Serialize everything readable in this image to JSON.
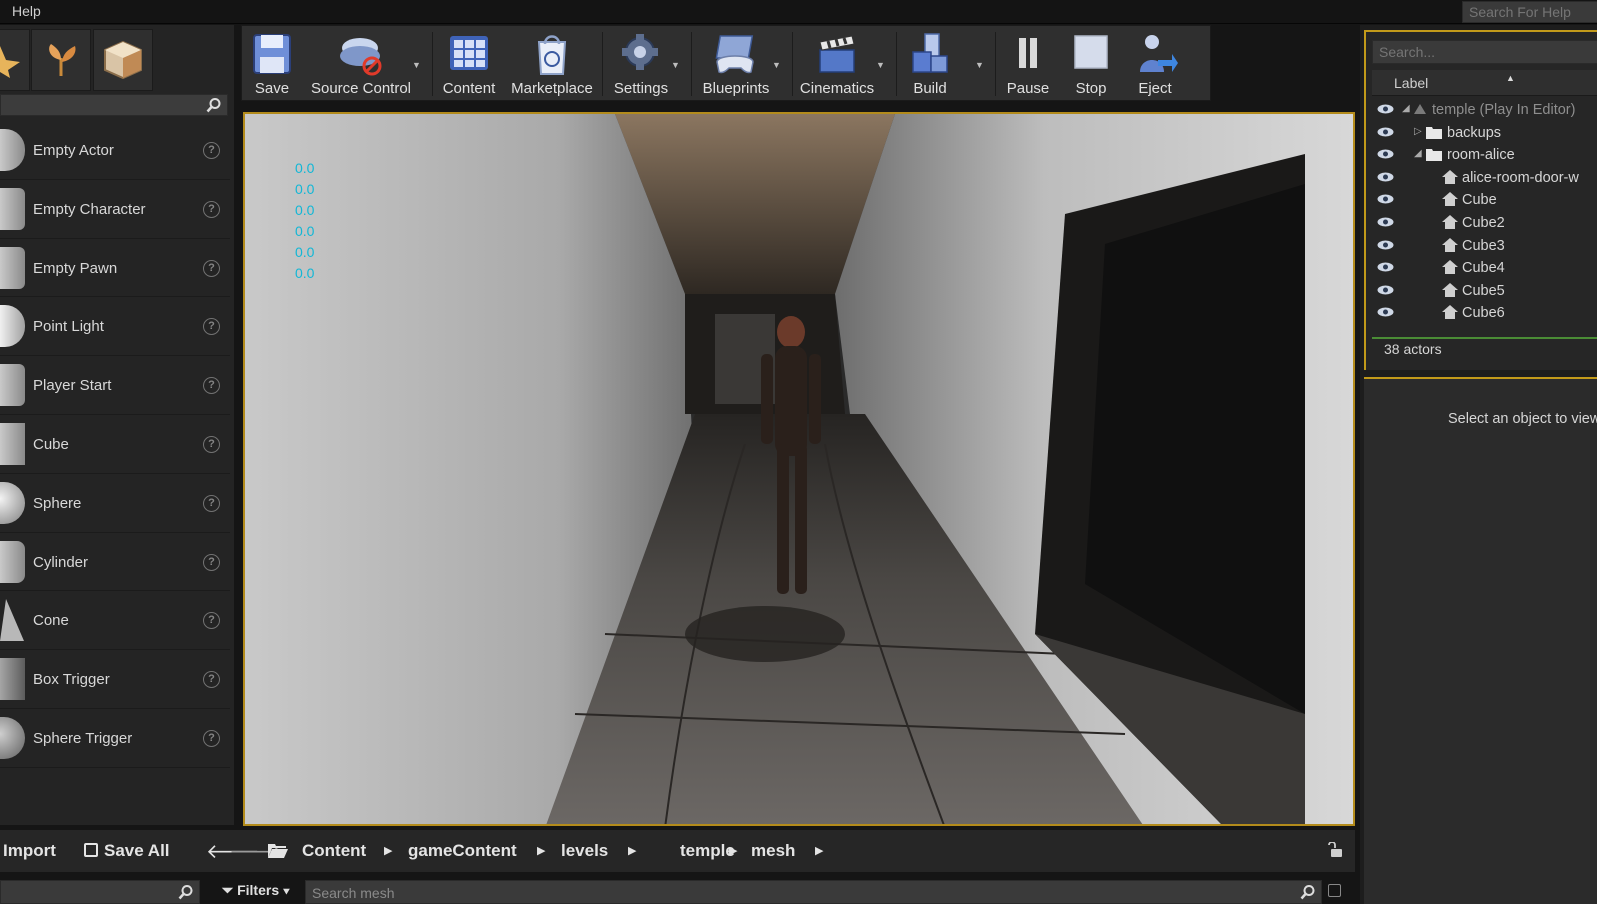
{
  "menu": {
    "help": "Help"
  },
  "help_search": {
    "placeholder": "Search For Help"
  },
  "place_panel": {
    "items": [
      {
        "label": "Empty Actor",
        "help": "?"
      },
      {
        "label": "Empty Character",
        "help": "?"
      },
      {
        "label": "Empty Pawn",
        "help": "?"
      },
      {
        "label": "Point Light",
        "help": "?"
      },
      {
        "label": "Player Start",
        "help": "?"
      },
      {
        "label": "Cube",
        "help": "?"
      },
      {
        "label": "Sphere",
        "help": "?"
      },
      {
        "label": "Cylinder",
        "help": "?"
      },
      {
        "label": "Cone",
        "help": "?"
      },
      {
        "label": "Box Trigger",
        "help": "?"
      },
      {
        "label": "Sphere Trigger",
        "help": "?"
      }
    ]
  },
  "toolbar": {
    "save": "Save",
    "source_control": "Source Control",
    "content": "Content",
    "marketplace": "Marketplace",
    "settings": "Settings",
    "blueprints": "Blueprints",
    "cinematics": "Cinematics",
    "build": "Build",
    "pause": "Pause",
    "stop": "Stop",
    "eject": "Eject"
  },
  "viewport": {
    "stats": [
      "0.0",
      "0.0",
      "0.0",
      "0.0",
      "0.0",
      "0.0"
    ]
  },
  "outliner": {
    "search_placeholder": "Search...",
    "label_column": "Label",
    "rows": [
      {
        "label": "temple (Play In Editor)"
      },
      {
        "label": "backups"
      },
      {
        "label": "room-alice"
      },
      {
        "label": "alice-room-door-w"
      },
      {
        "label": "Cube"
      },
      {
        "label": "Cube2"
      },
      {
        "label": "Cube3"
      },
      {
        "label": "Cube4"
      },
      {
        "label": "Cube5"
      },
      {
        "label": "Cube6"
      }
    ],
    "actor_count": "38 actors"
  },
  "details": {
    "message": "Select an object to view details."
  },
  "content_browser": {
    "import": "Import",
    "save_all": "Save All",
    "breadcrumbs": [
      "Content",
      "gameContent",
      "levels",
      "temple",
      "mesh"
    ],
    "filters": "Filters",
    "search_placeholder": "Search mesh"
  },
  "colors": {
    "accent_gold": "#c29a1a",
    "stat_cyan": "#12b7d6",
    "outliner_green": "#4a8c35"
  }
}
